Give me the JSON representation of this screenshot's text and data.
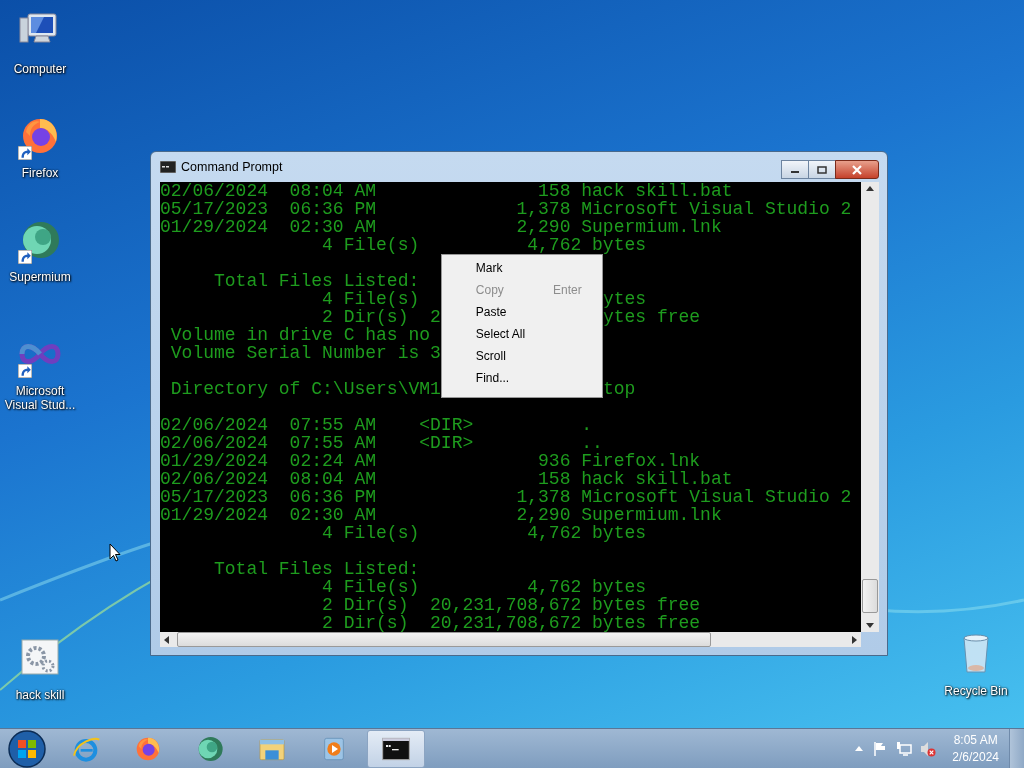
{
  "desktop_icons": [
    {
      "label": "Computer",
      "kind": "computer",
      "shortcut": false
    },
    {
      "label": "Firefox",
      "kind": "firefox",
      "shortcut": true
    },
    {
      "label": "Supermium",
      "kind": "supermium",
      "shortcut": true
    },
    {
      "label": "Microsoft Visual Stud...",
      "kind": "visualstudio",
      "shortcut": true
    },
    {
      "label": "hack skill",
      "kind": "batch",
      "shortcut": false
    },
    {
      "label": "Recycle Bin",
      "kind": "recycle",
      "shortcut": false
    }
  ],
  "window": {
    "title": "Command Prompt",
    "terminal_lines": [
      {
        "kind": "text",
        "text": "02/06/2024  08:04 AM               158 hack skill.bat"
      },
      {
        "kind": "text",
        "text": "05/17/2023  06:36 PM             1,378 Microsoft Visual Studio 2"
      },
      {
        "kind": "text",
        "text": "01/29/2024  02:30 AM             2,290 Supermium.lnk"
      },
      {
        "kind": "text",
        "text": "               4 File(s)          4,762 bytes"
      },
      {
        "kind": "blank"
      },
      {
        "kind": "text",
        "text": "     Total Files Listed:"
      },
      {
        "kind": "text",
        "text": "               4 File(s)",
        "right": "ytes"
      },
      {
        "kind": "text",
        "text": "               2 Dir(s)  2",
        "right": "ytes free"
      },
      {
        "kind": "text",
        "text": " Volume in drive C has no"
      },
      {
        "kind": "text",
        "text": " Volume Serial Number is 3"
      },
      {
        "kind": "blank"
      },
      {
        "kind": "text",
        "text": " Directory of C:\\Users\\VM1",
        "right": "top"
      },
      {
        "kind": "blank"
      },
      {
        "kind": "text",
        "text": "02/06/2024  07:55 AM    <DIR>          ."
      },
      {
        "kind": "text",
        "text": "02/06/2024  07:55 AM    <DIR>          .."
      },
      {
        "kind": "text",
        "text": "01/29/2024  02:24 AM               936 Firefox.lnk"
      },
      {
        "kind": "text",
        "text": "02/06/2024  08:04 AM               158 hack skill.bat"
      },
      {
        "kind": "text",
        "text": "05/17/2023  06:36 PM             1,378 Microsoft Visual Studio 2"
      },
      {
        "kind": "text",
        "text": "01/29/2024  02:30 AM             2,290 Supermium.lnk"
      },
      {
        "kind": "text",
        "text": "               4 File(s)          4,762 bytes"
      },
      {
        "kind": "blank"
      },
      {
        "kind": "text",
        "text": "     Total Files Listed:"
      },
      {
        "kind": "text",
        "text": "               4 File(s)          4,762 bytes"
      },
      {
        "kind": "text",
        "text": "               2 Dir(s)  20,231,708,672 bytes free"
      },
      {
        "kind": "text",
        "text": "               2 Dir(s)  20,231,708,672 bytes free"
      }
    ]
  },
  "context_menu": {
    "items": [
      {
        "label": "Mark",
        "disabled": false
      },
      {
        "label": "Copy",
        "shortcut": "Enter",
        "disabled": true
      },
      {
        "label": "Paste",
        "disabled": false
      },
      {
        "label": "Select All",
        "disabled": false
      },
      {
        "label": "Scroll",
        "disabled": false
      },
      {
        "label": "Find...",
        "disabled": false
      }
    ]
  },
  "taskbar": {
    "apps": [
      {
        "kind": "ie",
        "active": false
      },
      {
        "kind": "firefox",
        "active": false
      },
      {
        "kind": "supermium",
        "active": false
      },
      {
        "kind": "explorer",
        "active": false
      },
      {
        "kind": "mediaplayer",
        "active": false
      },
      {
        "kind": "cmd",
        "active": true
      }
    ]
  },
  "tray": {
    "time": "8:05 AM",
    "date": "2/6/2024"
  }
}
